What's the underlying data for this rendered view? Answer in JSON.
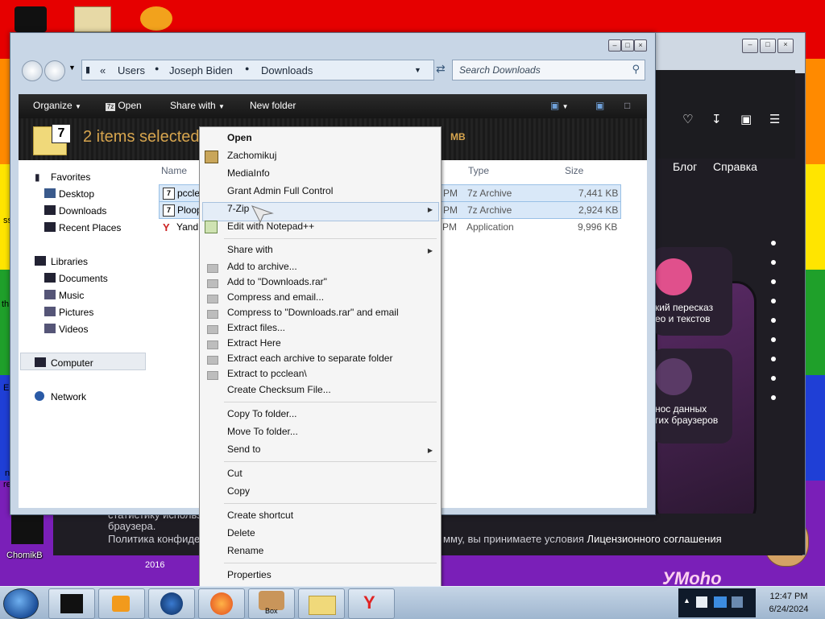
{
  "desktop": {
    "icons": [
      {
        "label": "ChomikB"
      },
      {
        "label": "ss"
      },
      {
        "label": "th"
      },
      {
        "label": "Er"
      },
      {
        "label": "n"
      },
      {
        "label": "re"
      }
    ],
    "hamster_text": "УМоhо"
  },
  "browser": {
    "nav": [
      "Блог",
      "Справка"
    ],
    "card1_text": "кий пересказ\nео и текстов",
    "card2_text": "нос данных\nгих браузеров",
    "bottom_left": "статистику использования",
    "bottom_left2": "браузера.",
    "bottom_left3": "Политика конфиденциальности",
    "bottom_right": "мму, вы принимаете условия ",
    "bottom_link": "Лицензионного соглашения",
    "year": "2016"
  },
  "explorer": {
    "breadcrumb": [
      "Users",
      "Joseph Biden",
      "Downloads"
    ],
    "search_placeholder": "Search Downloads",
    "toolbar": {
      "organize": "Organize",
      "open": "Open",
      "share_with": "Share with",
      "new_folder": "New folder"
    },
    "selection_text": "2 items selected",
    "selection_size": "MB",
    "nav": {
      "favorites": "Favorites",
      "desktop": "Desktop",
      "downloads": "Downloads",
      "recent": "Recent Places",
      "libraries": "Libraries",
      "documents": "Documents",
      "music": "Music",
      "pictures": "Pictures",
      "videos": "Videos",
      "computer": "Computer",
      "network": "Network"
    },
    "columns": {
      "name": "Name",
      "type": "Type",
      "size": "Size"
    },
    "files": [
      {
        "name": "pccle",
        "date_suffix": "PM",
        "type": "7z Archive",
        "size": "7,441 KB",
        "selected": true
      },
      {
        "name": "Ploop",
        "date_suffix": "PM",
        "type": "7z Archive",
        "size": "2,924 KB",
        "selected": true
      },
      {
        "name": "Yand",
        "date_suffix": "PM",
        "type": "Application",
        "size": "9,996 KB",
        "selected": false
      }
    ]
  },
  "context_menu": {
    "items": [
      "Open",
      "Zachomikuj",
      "MediaInfo",
      "Grant Admin Full Control",
      "7-Zip",
      "Edit with Notepad++",
      "Share with",
      "Add to archive...",
      "Add to \"Downloads.rar\"",
      "Compress and email...",
      "Compress to \"Downloads.rar\" and email",
      "Extract files...",
      "Extract Here",
      "Extract each archive to separate folder",
      "Extract to pcclean\\",
      "Create Checksum File...",
      "Copy To folder...",
      "Move To folder...",
      "Send to",
      "Cut",
      "Copy",
      "Create shortcut",
      "Delete",
      "Rename",
      "Properties"
    ]
  },
  "taskbar": {
    "time": "12:47 PM",
    "date": "6/24/2024",
    "box_label": "Box"
  }
}
